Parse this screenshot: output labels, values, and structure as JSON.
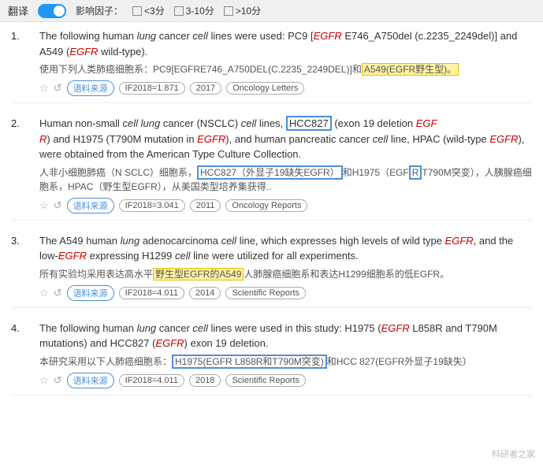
{
  "header": {
    "translate_label": "翻译",
    "if_label": "影响因子：",
    "options": [
      {
        "label": "<3分",
        "checked": false
      },
      {
        "label": "3-10分",
        "checked": false
      },
      {
        "label": ">10分",
        "checked": false
      }
    ]
  },
  "results": [
    {
      "number": "1.",
      "en_html": "The following human <i class='kw'>lung</i> cancer <i class='kw'>cell</i> lines were used: PC9 [<i class='kw' style='color:#c00'>EGFR</i> E746_A750del (c.2235_2249del)] and A549 (<i class='kw' style='color:#c00'>EGFR</i> wild-type).",
      "zh_html": "使用下列人类肺癌细胞系：PC9[EGFRE746_A750DEL(C.2235_2249DEL)]和<span class='hl-box'>A549(EGFR野生型)。</span>",
      "meta": {
        "if_value": "IF2018=1.871",
        "year": "2017",
        "journal": "Oncology Letters"
      }
    },
    {
      "number": "2.",
      "en_html": "Human non-small <i class='kw'>cell lung</i> cancer (NSCLC) <i class='kw'>cell</i> lines, <span class='hl-box-blue'>HCC827</span> (exon 19 deletion <i class='kw' style='color:#c00'>EGF<br>R</i>) and H1975 (T790M mutation in <i class='kw' style='color:#c00'>EGFR</i>), and human pancreatic cancer <i class='kw'>cell</i> line, HPAC (wild-type <i class='kw' style='color:#c00'>EGFR</i>), were obtained from the American Type Culture Collection.",
      "zh_html": "人非小细胞肺癌（N SCLC）细胞系，<span class='hl-box-blue'>HCC827（外显子19缺失EGFR）</span>和H1975（EGF<span class='hl-box-blue'>R</span>T790M突变），人胰腺癌细胞系，HPAC（野生型EGFR），从美国类型培养集获得..",
      "meta": {
        "if_value": "IF2018=3.041",
        "year": "2011",
        "journal": "Oncology Reports"
      }
    },
    {
      "number": "3.",
      "en_html": "The A549 human <i class='kw'>lung</i> adenocarcinoma <i class='kw'>cell</i> line, which expresses high levels of wild type <i class='kw' style='color:#c00'>EGFR</i>, and the low-<i class='kw' style='color:#c00'>EGFR</i> expressing H1299 <i class='kw'>cell</i> line were utilized for all experiments.",
      "zh_html": "所有实验均采用表达高水平<span class='hl-box'>野生型EGFR的A549</span>人肺腺癌细胞系和表达H1299细胞系的低EGFR。",
      "meta": {
        "if_value": "IF2018=4.011",
        "year": "2014",
        "journal": "Scientific Reports"
      }
    },
    {
      "number": "4.",
      "en_html": "The following human <i class='kw'>lung</i> cancer <i class='kw'>cell</i> lines were used in this study: H1975 (<i class='kw' style='color:#c00'>EGFR</i> L858R and T790M mutations) and HCC827 (<i class='kw' style='color:#c00'>EGFR</i>) exon 19 deletion.",
      "zh_html": "本研究采用以下人肺癌细胞系：<span class='hl-box-blue'>H1975(EGFR L858R和T790M突变)</span>和HCC 827(EGFR外显子19缺失）",
      "meta": {
        "if_value": "IF2018=4.011",
        "year": "2018",
        "journal": "Scientific Reports"
      }
    }
  ],
  "tags": {
    "source": "语料来源"
  },
  "watermark": "科研者之家"
}
